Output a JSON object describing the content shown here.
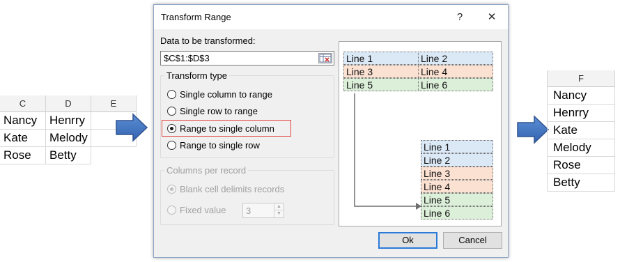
{
  "left_sheet": {
    "columns": [
      "C",
      "D",
      "E"
    ],
    "rows": [
      [
        "Nancy",
        "Henrry"
      ],
      [
        "Kate",
        "Melody"
      ],
      [
        "Rose",
        "Betty"
      ]
    ]
  },
  "right_sheet": {
    "column": "F",
    "values": [
      "Nancy",
      "Henrry",
      "Kate",
      "Melody",
      "Rose",
      "Betty"
    ]
  },
  "dialog": {
    "title": "Transform Range",
    "help_icon": "?",
    "close_icon": "✕",
    "data_label": "Data to be transformed:",
    "range_value": "$C$1:$D$3",
    "transform_type": {
      "legend": "Transform type",
      "options": [
        "Single column to range",
        "Single row to range",
        "Range to single column",
        "Range to single row"
      ],
      "selected": "Range to single column"
    },
    "columns_per_record": {
      "legend": "Columns per record",
      "blank_cell": "Blank cell delimits records",
      "fixed_value": "Fixed value",
      "fixed_number": "3"
    },
    "preview": {
      "source": [
        [
          "Line 1",
          "Line 2"
        ],
        [
          "Line 3",
          "Line 4"
        ],
        [
          "Line 5",
          "Line 6"
        ]
      ],
      "result": [
        "Line 1",
        "Line 2",
        "Line 3",
        "Line 4",
        "Line 5",
        "Line 6"
      ]
    },
    "ok_label": "Ok",
    "cancel_label": "Cancel"
  },
  "colors": {
    "accent": "#2a7ad9",
    "arrow": "#4472c4",
    "highlight": "#e0403a",
    "preview_blue": "#dbe8f6",
    "preview_orange": "#fbe1d2",
    "preview_green": "#dcefd9"
  }
}
